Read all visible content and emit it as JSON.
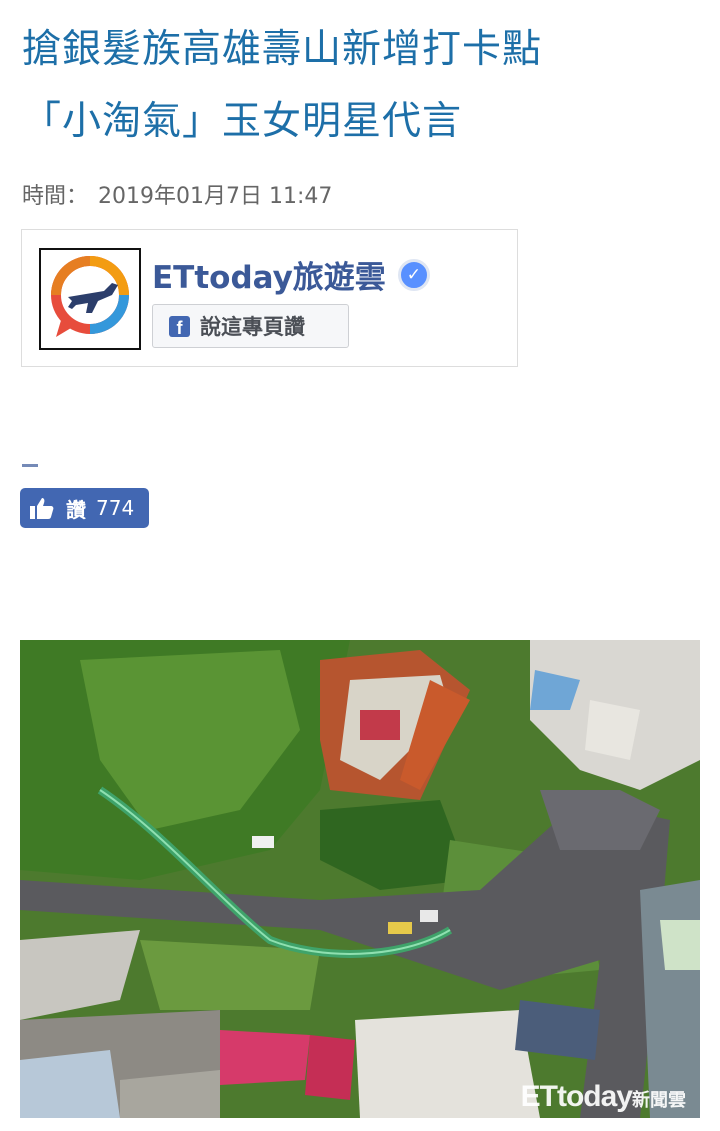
{
  "article": {
    "title_line1": "搶銀髮族高雄壽山新增打卡點",
    "title_line2": "「小淘氣」玉女明星代言",
    "time_label": "時間：",
    "time_value": "2019年01月7日 11:47"
  },
  "fb_page": {
    "name": "ETtoday旅遊雲",
    "like_page_label": "說這專頁讚",
    "verified_icon": "verified-check-icon"
  },
  "like_button": {
    "label": "讚",
    "count": "774"
  },
  "photo": {
    "watermark_brand": "ETtoday",
    "watermark_suffix": "新聞雲"
  },
  "colors": {
    "headline": "#1d6fa8",
    "facebook_blue": "#4267b2"
  }
}
